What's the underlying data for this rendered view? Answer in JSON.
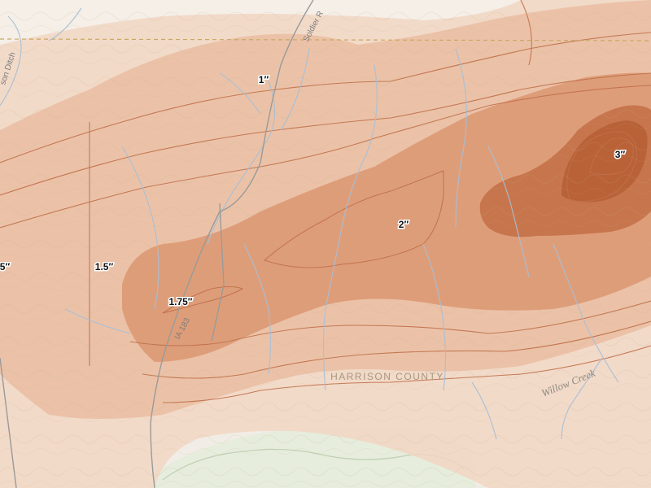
{
  "map": {
    "county_label": "HARRISON COUNTY",
    "road_labels": [
      "IA 183",
      "Soldier R",
      "son Ditch"
    ],
    "water_labels": [
      "Willow Creek"
    ],
    "contour_labels": [
      "1″",
      "1.5″",
      "1.75″",
      "2″",
      "3″",
      "5″"
    ],
    "colors": {
      "base": "#f1ede6",
      "level_1": "#f3d4c2",
      "level_1_5": "#e5ae8d",
      "level_2": "#d7895f",
      "level_3": "#b85a2e",
      "contour_line": "#c0704a",
      "river": "#a8bfd6",
      "road": "#9a9a9a",
      "county_line": "#c9a860"
    }
  }
}
